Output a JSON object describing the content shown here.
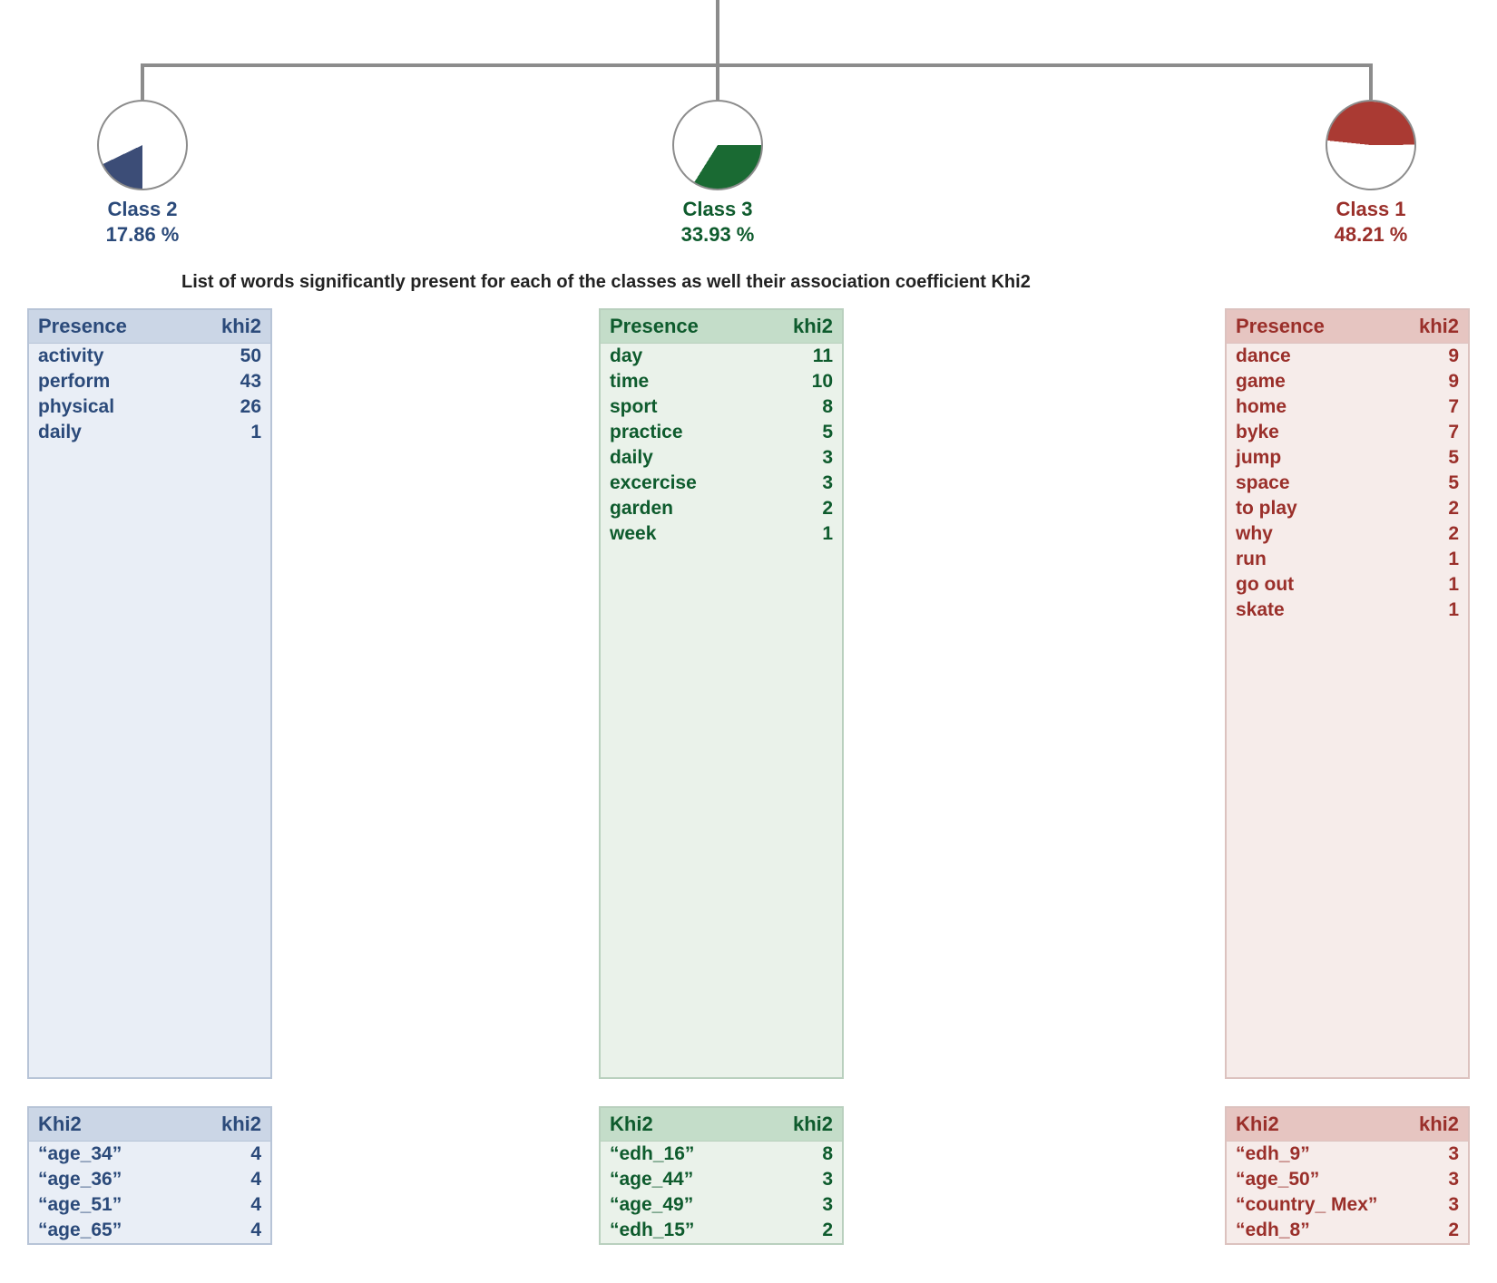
{
  "caption": "List of words significantly present for each of the classes as well their association coefficient Khi2",
  "headers": {
    "presence": "Presence",
    "khi2": "khi2",
    "khi2_title": "Khi2"
  },
  "chart_data": {
    "type": "pie",
    "title": "Dendrogram of word classes with percentage share",
    "series": [
      {
        "name": "Class 2",
        "value": 17.86,
        "color": "#3c4d77"
      },
      {
        "name": "Class 3",
        "value": 33.93,
        "color": "#1a6a33"
      },
      {
        "name": "Class 1",
        "value": 48.21,
        "color": "#aa3a33"
      }
    ]
  },
  "classes": {
    "class2": {
      "label": "Class 2",
      "pct": "17.86 %",
      "color": "#3c4d77",
      "presence": [
        {
          "word": "activity",
          "khi2": 50
        },
        {
          "word": "perform",
          "khi2": 43
        },
        {
          "word": "physical",
          "khi2": 26
        },
        {
          "word": "daily",
          "khi2": 1
        }
      ],
      "khi2vars": [
        {
          "word": "“age_34”",
          "khi2": 4
        },
        {
          "word": "“age_36”",
          "khi2": 4
        },
        {
          "word": "“age_51”",
          "khi2": 4
        },
        {
          "word": "“age_65”",
          "khi2": 4
        }
      ]
    },
    "class3": {
      "label": "Class 3",
      "pct": "33.93 %",
      "color": "#1a6a33",
      "presence": [
        {
          "word": "day",
          "khi2": 11
        },
        {
          "word": "time",
          "khi2": 10
        },
        {
          "word": "sport",
          "khi2": 8
        },
        {
          "word": "practice",
          "khi2": 5
        },
        {
          "word": "daily",
          "khi2": 3
        },
        {
          "word": "excercise",
          "khi2": 3
        },
        {
          "word": "garden",
          "khi2": 2
        },
        {
          "word": "week",
          "khi2": 1
        }
      ],
      "khi2vars": [
        {
          "word": "“edh_16”",
          "khi2": 8
        },
        {
          "word": "“age_44”",
          "khi2": 3
        },
        {
          "word": "“age_49”",
          "khi2": 3
        },
        {
          "word": "“edh_15”",
          "khi2": 2
        }
      ]
    },
    "class1": {
      "label": "Class 1",
      "pct": "48.21 %",
      "color": "#aa3a33",
      "presence": [
        {
          "word": "dance",
          "khi2": 9
        },
        {
          "word": "game",
          "khi2": 9
        },
        {
          "word": "home",
          "khi2": 7
        },
        {
          "word": "byke",
          "khi2": 7
        },
        {
          "word": "jump",
          "khi2": 5
        },
        {
          "word": "space",
          "khi2": 5
        },
        {
          "word": "to play",
          "khi2": 2
        },
        {
          "word": "why",
          "khi2": 2
        },
        {
          "word": "run",
          "khi2": 1
        },
        {
          "word": "go out",
          "khi2": 1
        },
        {
          "word": "skate",
          "khi2": 1
        }
      ],
      "khi2vars": [
        {
          "word": "“edh_9”",
          "khi2": 3
        },
        {
          "word": "“age_50”",
          "khi2": 3
        },
        {
          "word": "“country_ Mex”",
          "khi2": 3
        },
        {
          "word": "“edh_8”",
          "khi2": 2
        }
      ]
    }
  }
}
